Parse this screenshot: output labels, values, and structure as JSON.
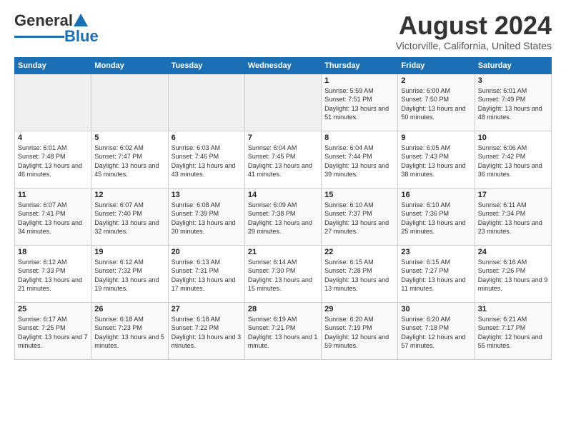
{
  "header": {
    "logo_general": "General",
    "logo_blue": "Blue",
    "title": "August 2024",
    "subtitle": "Victorville, California, United States"
  },
  "weekdays": [
    "Sunday",
    "Monday",
    "Tuesday",
    "Wednesday",
    "Thursday",
    "Friday",
    "Saturday"
  ],
  "weeks": [
    [
      {
        "day": "",
        "empty": true
      },
      {
        "day": "",
        "empty": true
      },
      {
        "day": "",
        "empty": true
      },
      {
        "day": "",
        "empty": true
      },
      {
        "day": "1",
        "sunrise": "5:59 AM",
        "sunset": "7:51 PM",
        "daylight": "13 hours and 51 minutes."
      },
      {
        "day": "2",
        "sunrise": "6:00 AM",
        "sunset": "7:50 PM",
        "daylight": "13 hours and 50 minutes."
      },
      {
        "day": "3",
        "sunrise": "6:01 AM",
        "sunset": "7:49 PM",
        "daylight": "13 hours and 48 minutes."
      }
    ],
    [
      {
        "day": "4",
        "sunrise": "6:01 AM",
        "sunset": "7:48 PM",
        "daylight": "13 hours and 46 minutes."
      },
      {
        "day": "5",
        "sunrise": "6:02 AM",
        "sunset": "7:47 PM",
        "daylight": "13 hours and 45 minutes."
      },
      {
        "day": "6",
        "sunrise": "6:03 AM",
        "sunset": "7:46 PM",
        "daylight": "13 hours and 43 minutes."
      },
      {
        "day": "7",
        "sunrise": "6:04 AM",
        "sunset": "7:45 PM",
        "daylight": "13 hours and 41 minutes."
      },
      {
        "day": "8",
        "sunrise": "6:04 AM",
        "sunset": "7:44 PM",
        "daylight": "13 hours and 39 minutes."
      },
      {
        "day": "9",
        "sunrise": "6:05 AM",
        "sunset": "7:43 PM",
        "daylight": "13 hours and 38 minutes."
      },
      {
        "day": "10",
        "sunrise": "6:06 AM",
        "sunset": "7:42 PM",
        "daylight": "13 hours and 36 minutes."
      }
    ],
    [
      {
        "day": "11",
        "sunrise": "6:07 AM",
        "sunset": "7:41 PM",
        "daylight": "13 hours and 34 minutes."
      },
      {
        "day": "12",
        "sunrise": "6:07 AM",
        "sunset": "7:40 PM",
        "daylight": "13 hours and 32 minutes."
      },
      {
        "day": "13",
        "sunrise": "6:08 AM",
        "sunset": "7:39 PM",
        "daylight": "13 hours and 30 minutes."
      },
      {
        "day": "14",
        "sunrise": "6:09 AM",
        "sunset": "7:38 PM",
        "daylight": "13 hours and 29 minutes."
      },
      {
        "day": "15",
        "sunrise": "6:10 AM",
        "sunset": "7:37 PM",
        "daylight": "13 hours and 27 minutes."
      },
      {
        "day": "16",
        "sunrise": "6:10 AM",
        "sunset": "7:36 PM",
        "daylight": "13 hours and 25 minutes."
      },
      {
        "day": "17",
        "sunrise": "6:11 AM",
        "sunset": "7:34 PM",
        "daylight": "13 hours and 23 minutes."
      }
    ],
    [
      {
        "day": "18",
        "sunrise": "6:12 AM",
        "sunset": "7:33 PM",
        "daylight": "13 hours and 21 minutes."
      },
      {
        "day": "19",
        "sunrise": "6:12 AM",
        "sunset": "7:32 PM",
        "daylight": "13 hours and 19 minutes."
      },
      {
        "day": "20",
        "sunrise": "6:13 AM",
        "sunset": "7:31 PM",
        "daylight": "13 hours and 17 minutes."
      },
      {
        "day": "21",
        "sunrise": "6:14 AM",
        "sunset": "7:30 PM",
        "daylight": "13 hours and 15 minutes."
      },
      {
        "day": "22",
        "sunrise": "6:15 AM",
        "sunset": "7:28 PM",
        "daylight": "13 hours and 13 minutes."
      },
      {
        "day": "23",
        "sunrise": "6:15 AM",
        "sunset": "7:27 PM",
        "daylight": "13 hours and 11 minutes."
      },
      {
        "day": "24",
        "sunrise": "6:16 AM",
        "sunset": "7:26 PM",
        "daylight": "13 hours and 9 minutes."
      }
    ],
    [
      {
        "day": "25",
        "sunrise": "6:17 AM",
        "sunset": "7:25 PM",
        "daylight": "13 hours and 7 minutes."
      },
      {
        "day": "26",
        "sunrise": "6:18 AM",
        "sunset": "7:23 PM",
        "daylight": "13 hours and 5 minutes."
      },
      {
        "day": "27",
        "sunrise": "6:18 AM",
        "sunset": "7:22 PM",
        "daylight": "13 hours and 3 minutes."
      },
      {
        "day": "28",
        "sunrise": "6:19 AM",
        "sunset": "7:21 PM",
        "daylight": "13 hours and 1 minute."
      },
      {
        "day": "29",
        "sunrise": "6:20 AM",
        "sunset": "7:19 PM",
        "daylight": "12 hours and 59 minutes."
      },
      {
        "day": "30",
        "sunrise": "6:20 AM",
        "sunset": "7:18 PM",
        "daylight": "12 hours and 57 minutes."
      },
      {
        "day": "31",
        "sunrise": "6:21 AM",
        "sunset": "7:17 PM",
        "daylight": "12 hours and 55 minutes."
      }
    ]
  ]
}
